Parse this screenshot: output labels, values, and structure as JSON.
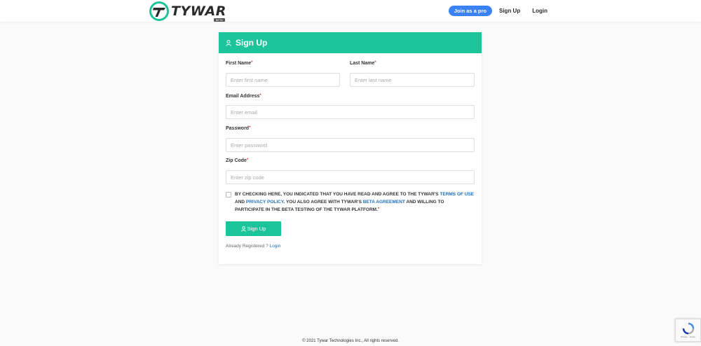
{
  "nav": {
    "logo_text": "TYWAR",
    "logo_badge": "BETA",
    "join_pro": "Join as a pro",
    "signup": "Sign Up",
    "login": "Login"
  },
  "form": {
    "title": "Sign Up",
    "first_name": {
      "label": "First Name",
      "placeholder": "Enter first name"
    },
    "last_name": {
      "label": "Last Name",
      "placeholder": "Enter last name"
    },
    "email": {
      "label": "Email Address",
      "placeholder": "Enter email"
    },
    "password": {
      "label": "Password",
      "placeholder": "Enter password"
    },
    "zip": {
      "label": "Zip Code",
      "placeholder": "Enter zip code"
    },
    "required_mark": "*",
    "terms": {
      "part1": "BY CHECKING HERE, YOU INDICATED THAT YOU HAVE READ AND AGREE TO THE TYWAR'S ",
      "terms_link": "TERMS OF USE",
      "part2": " AND ",
      "privacy_link": "PRIVACY POLICY",
      "part3": ". YOU ALSO AGREE WITH TYWAR'S ",
      "beta_link": "BETA AGREEMENT",
      "part4": " AND WILLING TO PARTICIPATE IN THE BETA TESTING OF THE TYWAR PLATFORM."
    },
    "submit": "Sign Up",
    "already_text": "Already Registered ? ",
    "login_link": "Login"
  },
  "footer": {
    "copyright": "© 2021 Tywar Technologies Inc., All rights reserved."
  },
  "recaptcha": {
    "text": "Privacy - Terms"
  },
  "colors": {
    "brand": "#1cc49b",
    "pro_button": "#3b82f6",
    "link": "#1f6fb8"
  }
}
